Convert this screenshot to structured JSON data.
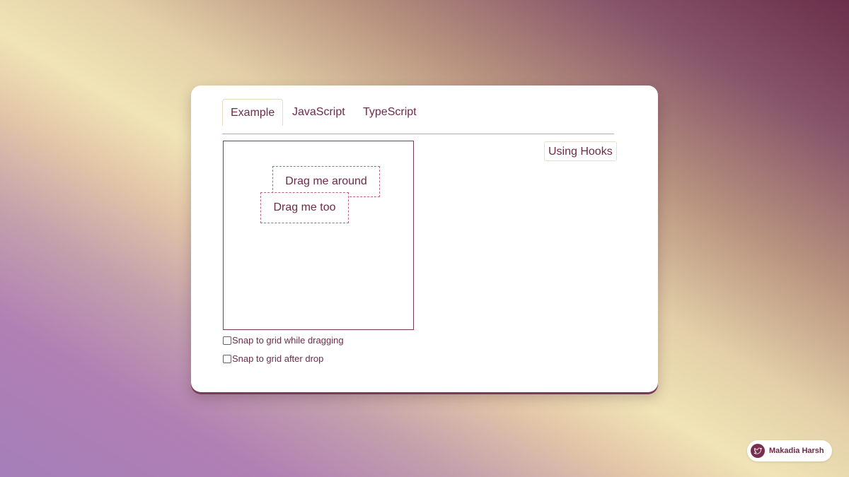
{
  "tabs": [
    {
      "label": "Example",
      "active": true
    },
    {
      "label": "JavaScript",
      "active": false
    },
    {
      "label": "TypeScript",
      "active": false
    }
  ],
  "demo": {
    "draggables": [
      {
        "label": "Drag me around"
      },
      {
        "label": "Drag me too"
      }
    ],
    "options": [
      {
        "label": "Snap to grid while dragging",
        "checked": false
      },
      {
        "label": "Snap to grid after drop",
        "checked": false
      }
    ]
  },
  "hooks_button": {
    "label": "Using Hooks"
  },
  "author": {
    "name": "Makadia Harsh",
    "icon": "bird-icon"
  },
  "colors": {
    "accent": "#6e2a46",
    "border": "#7a3a56"
  }
}
